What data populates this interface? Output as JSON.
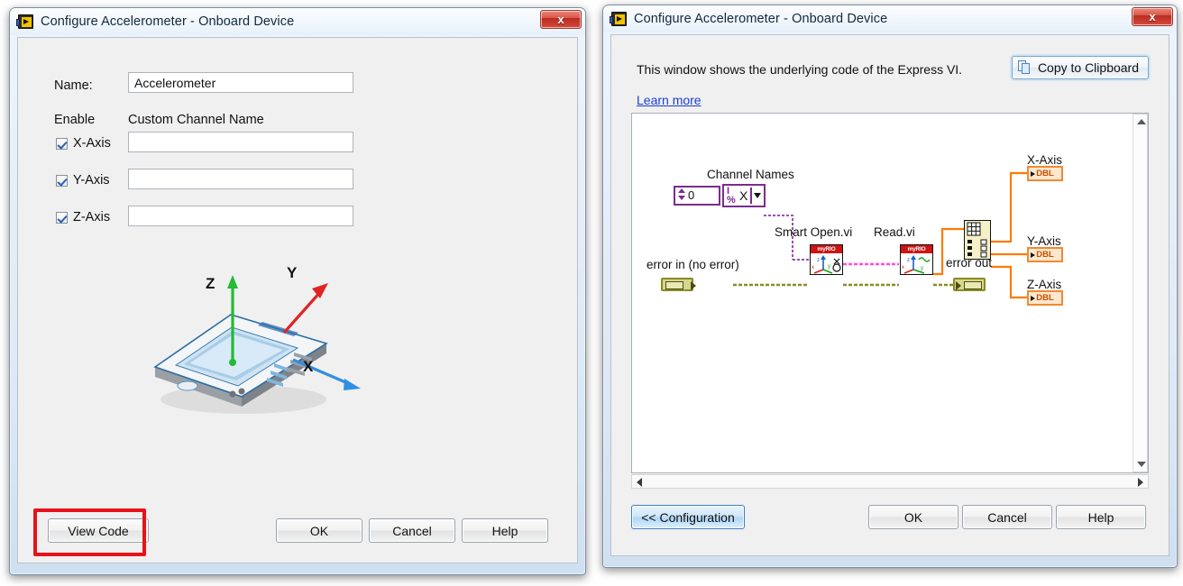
{
  "left_dialog": {
    "title": "Configure Accelerometer - Onboard Device",
    "icon": "labview-vi-icon",
    "close_label": "x",
    "name_label": "Name:",
    "name_value": "Accelerometer",
    "enable_header": "Enable",
    "custom_channel_header": "Custom Channel Name",
    "axes": [
      {
        "label": "X-Axis",
        "checked": true,
        "custom_name": ""
      },
      {
        "label": "Y-Axis",
        "checked": true,
        "custom_name": ""
      },
      {
        "label": "Z-Axis",
        "checked": true,
        "custom_name": ""
      }
    ],
    "illustration": {
      "name": "myrio-device-axes-diagram",
      "axis_labels": {
        "x": "X",
        "y": "Y",
        "z": "Z"
      },
      "axis_colors": {
        "x": "#2f8fe0",
        "y": "#e02424",
        "z": "#22bb33"
      }
    },
    "buttons": {
      "view_code": "View Code",
      "ok": "OK",
      "cancel": "Cancel",
      "help": "Help"
    },
    "highlight_color": "#e8121a"
  },
  "right_dialog": {
    "title": "Configure Accelerometer - Onboard Device",
    "icon": "labview-vi-icon",
    "close_label": "x",
    "hint_text": "This window shows the underlying code of the Express VI.",
    "copy_button": "Copy to Clipboard",
    "learn_more": "Learn more",
    "block_diagram": {
      "labels": {
        "channel_names": "Channel Names",
        "error_in": "error in (no error)",
        "smart_open": "Smart Open.vi",
        "read": "Read.vi",
        "error_out": "error out",
        "x_axis": "X-Axis",
        "y_axis": "Y-Axis",
        "z_axis": "Z-Axis"
      },
      "array_index_value": "0",
      "string_element": "X",
      "vi_banner": "myRIO",
      "indicator_type": "DBL",
      "wire_colors": {
        "error": "#8a8a24",
        "refnum": "#ff66cc",
        "array": "#9b4fb0",
        "numeric": "#ff7a00"
      }
    },
    "buttons": {
      "configuration": "<< Configuration",
      "ok": "OK",
      "cancel": "Cancel",
      "help": "Help"
    }
  }
}
